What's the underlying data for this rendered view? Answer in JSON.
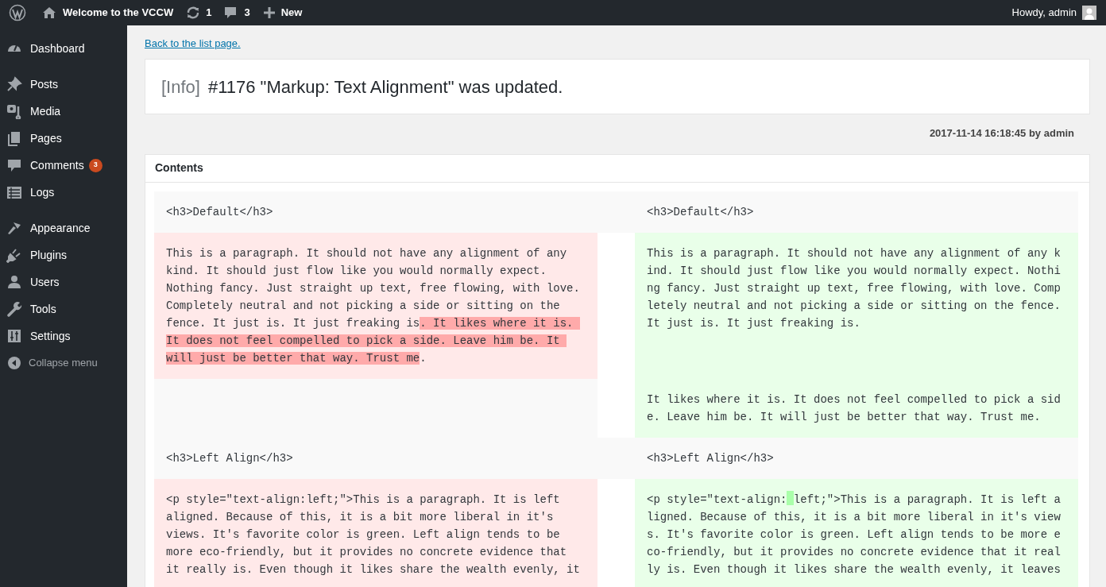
{
  "admin_bar": {
    "site_title": "Welcome to the VCCW",
    "updates_count": "1",
    "comments_count": "3",
    "new_label": "New",
    "greeting": "Howdy, admin"
  },
  "sidebar": {
    "groups": [
      [
        {
          "label": "Dashboard"
        }
      ],
      [
        {
          "label": "Posts"
        },
        {
          "label": "Media"
        },
        {
          "label": "Pages"
        },
        {
          "label": "Comments",
          "badge": "3"
        },
        {
          "label": "Logs"
        }
      ],
      [
        {
          "label": "Appearance"
        },
        {
          "label": "Plugins"
        },
        {
          "label": "Users"
        },
        {
          "label": "Tools"
        },
        {
          "label": "Settings"
        }
      ]
    ],
    "collapse_label": "Collapse menu"
  },
  "back_link": "Back to the list page.",
  "notice": {
    "level": "[Info]",
    "message": "#1176 \"Markup: Text Alignment\" was updated."
  },
  "meta": "2017-11-14 16:18:45 by admin",
  "diff": {
    "title": "Contents",
    "rows": [
      {
        "kind": "context",
        "left": [
          {
            "text": "<h3>Default</h3>",
            "changed": false
          }
        ],
        "right": [
          {
            "text": "<h3>Default</h3>",
            "changed": false
          }
        ]
      },
      {
        "kind": "change",
        "left": [
          {
            "text": "This is a paragraph. It should not have any alignment of any kind. It should just flow like you would normally expect. Nothing fancy. Just straight up text, free flowing, with love. Completely neutral and not picking a side or sitting on the fence. It just is. It just freaking is",
            "changed": false
          },
          {
            "text": ". It likes where it is. It does not feel compelled to pick a side. Leave him be. It will just be better that way. Trust me",
            "changed": true
          },
          {
            "text": ".",
            "changed": false
          }
        ],
        "right": [
          {
            "text": "This is a paragraph. It should not have any alignment of any kind. It should just flow like you would normally expect. Nothing fancy. Just straight up text, free flowing, with love. Completely neutral and not picking a side or sitting on the fence. It just is. It just freaking is.",
            "changed": false
          }
        ]
      },
      {
        "kind": "add",
        "left": [],
        "right": [
          {
            "text": "It likes where it is. It does not feel compelled to pick a side. Leave him be. It will just be better that way. Trust me.",
            "changed": false
          }
        ]
      },
      {
        "kind": "context",
        "left": [
          {
            "text": "<h3>Left Align</h3>",
            "changed": false
          }
        ],
        "right": [
          {
            "text": "<h3>Left Align</h3>",
            "changed": false
          }
        ]
      },
      {
        "kind": "change",
        "left": [
          {
            "text": "<p style=\"text-align:left;\">This is a paragraph. It is left aligned. Because of this, it is a bit more liberal in it's views. It's favorite color is green. Left align tends to be more eco-friendly, but it provides no concrete evidence that it really is. Even though it likes share the wealth evenly, it",
            "changed": false
          }
        ],
        "right": [
          {
            "text": "<p style=\"text-align:",
            "changed": false
          },
          {
            "changed": true
          },
          {
            "text": "left;\">This is a paragraph. It is left aligned. Because of this, it is a bit more liberal in it's views. It's favorite color is green. Left align tends to be more eco-friendly, but it provides no concrete evidence that it really is. Even though it likes share the wealth evenly, it leaves",
            "changed": false
          }
        ]
      }
    ]
  }
}
